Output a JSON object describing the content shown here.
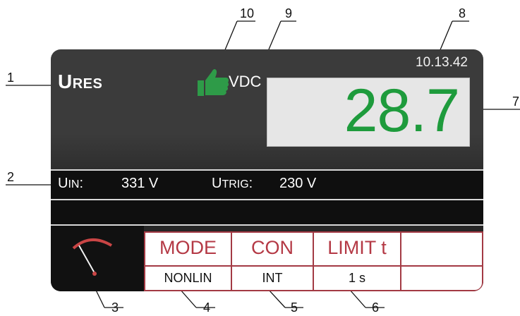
{
  "callouts": [
    "1",
    "2",
    "3",
    "4",
    "5",
    "6",
    "7",
    "8",
    "9",
    "10"
  ],
  "screen": {
    "clock": "10.13.42",
    "title_main": "U",
    "title_sub": "RES",
    "status_icon": "thumbs-up-icon",
    "status_color": "#2e9b48",
    "unit": "VDC",
    "value": "28.7",
    "value_color": "#1e9b3c"
  },
  "info": {
    "uin_main": "U",
    "uin_sub": "IN",
    "uin_suffix": ":",
    "uin_value": "331 V",
    "utrig_main": "U",
    "utrig_sub": "TRIG",
    "utrig_suffix": ":",
    "utrig_value": "230 V"
  },
  "meter": {
    "icon": "meter-gauge-icon"
  },
  "softkeys": [
    {
      "label": "MODE",
      "value": "NONLIN"
    },
    {
      "label": "CON",
      "value": "INT"
    },
    {
      "label": "LIMIT t",
      "value": "1 s"
    },
    {
      "label": "",
      "value": ""
    }
  ],
  "colors": {
    "softkey_accent": "#a33a44",
    "softkey_text": "#b43945"
  }
}
